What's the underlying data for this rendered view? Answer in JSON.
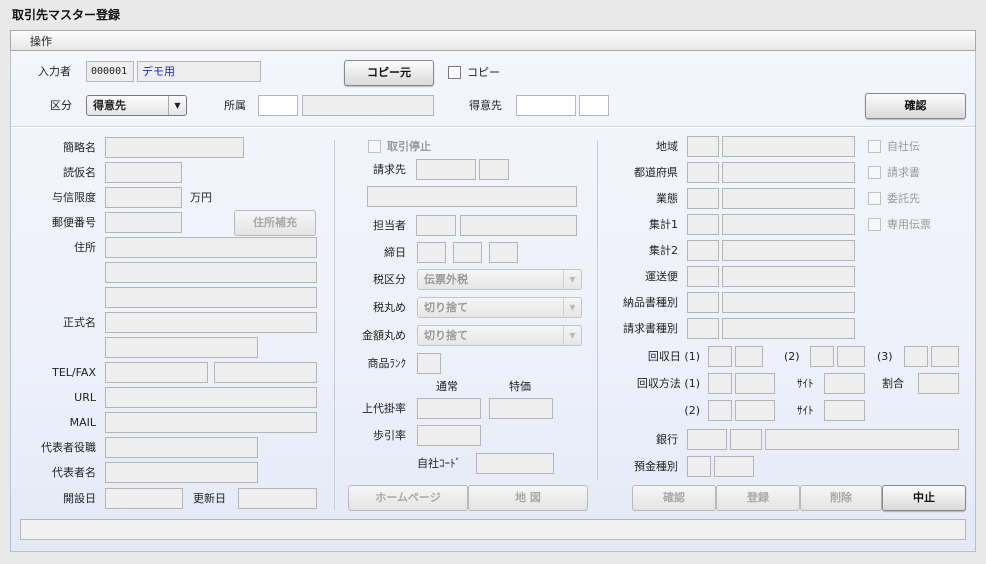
{
  "window": {
    "title": "取引先マスター登録"
  },
  "menu": {
    "operation": "操作"
  },
  "header": {
    "inputter_label": "入力者",
    "inputter_code": "000001",
    "inputter_name": "デモ用",
    "copy_source_button": "コピー元",
    "copy_checkbox": "コピー",
    "division_label": "区分",
    "division_value": "得意先",
    "affiliation_label": "所属",
    "customer_label": "得意先",
    "confirm_button": "確認"
  },
  "left": {
    "short_name": "簡略名",
    "kana_name": "読仮名",
    "credit_limit": "与信限度",
    "credit_unit": "万円",
    "postal_code": "郵便番号",
    "address_complete_button": "住所補充",
    "address": "住所",
    "official_name": "正式名",
    "telfax": "TEL/FAX",
    "url": "URL",
    "mail": "MAIL",
    "rep_title": "代表者役職",
    "rep_name": "代表者名",
    "open_date": "開設日",
    "update_date": "更新日"
  },
  "middle": {
    "suspend": "取引停止",
    "billing_to": "請求先",
    "person_in_charge": "担当者",
    "closing_day": "締日",
    "tax_class": "税区分",
    "tax_class_value": "伝票外税",
    "tax_round": "税丸め",
    "tax_round_value": "切り捨て",
    "amount_round": "金額丸め",
    "amount_round_value": "切り捨て",
    "product_rank": "商品ﾗﾝｸ",
    "normal": "通常",
    "special": "特価",
    "list_price_rate": "上代掛率",
    "discount_rate": "歩引率",
    "company_code": "自社ｺｰﾄﾞ",
    "homepage_button": "ホームページ",
    "map_button": "地 図"
  },
  "right": {
    "region": "地域",
    "prefecture": "都道府県",
    "business_type": "業態",
    "total1": "集計1",
    "total2": "集計2",
    "shipping": "運送便",
    "delivery_slip_type": "納品書種別",
    "invoice_type": "請求書種別",
    "collection_day": "回収日 (1)",
    "cd2": "(2)",
    "cd3": "(3)",
    "collection_method": "回収方法 (1)",
    "site": "ｻｲﾄ",
    "ratio": "割合",
    "cm2": "(2)",
    "site2": "ｻｲﾄ",
    "bank": "銀行",
    "deposit_type": "預金種別",
    "own_slip": "自社伝",
    "invoice": "請求書",
    "consignment": "委託先",
    "dedicated_slip": "専用伝票"
  },
  "footer": {
    "confirm": "確認",
    "register": "登録",
    "delete": "削除",
    "cancel": "中止"
  }
}
